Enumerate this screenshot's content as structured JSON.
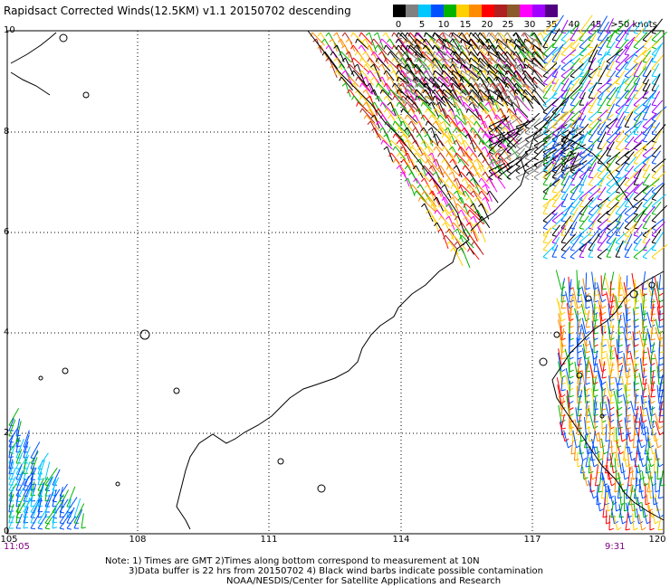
{
  "title": "Rapidsact Corrected Winds(12.5KM) v1.1 20150702 descending",
  "legend": {
    "colors": [
      "#000000",
      "#808080",
      "#00c8ff",
      "#0050ff",
      "#00b400",
      "#ffd000",
      "#ff8c00",
      "#ff0000",
      "#b02020",
      "#8b5a2b",
      "#ff00ff",
      "#a000ff",
      "#500080"
    ],
    "labels": [
      "0",
      "5",
      "10",
      "15",
      "20",
      "25",
      "30",
      "35",
      "40",
      "45",
      ">50 knots"
    ]
  },
  "axes": {
    "lat_labels": [
      "10",
      "8",
      "6",
      "4",
      "2",
      "0"
    ],
    "lon_labels": [
      "105",
      "108",
      "111",
      "114",
      "117",
      "120"
    ]
  },
  "times": {
    "left": "11:05",
    "right": "9:31"
  },
  "notes": [
    "Note: 1) Times are GMT 2)Times along bottom correspond to measurement at 10N",
    "3)Data buffer is 22 hrs from 20150702 4) Black wind barbs indicate possible contamination",
    "NOAA/NESDIS/Center for Satellite Applications and Research"
  ]
}
